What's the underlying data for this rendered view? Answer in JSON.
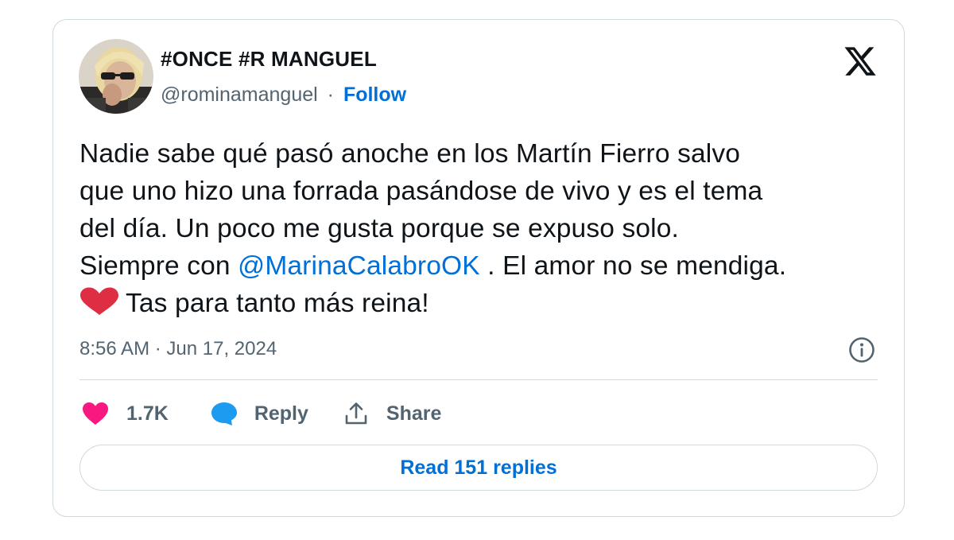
{
  "author": {
    "display_name": "#ONCE #R MANGUEL",
    "handle": "@rominamanguel",
    "separator": "·",
    "follow_label": "Follow",
    "avatar_icon": "avatar-photo"
  },
  "brand": {
    "logo_icon": "x-logo-icon"
  },
  "tweet": {
    "line1": "Nadie sabe qué pasó anoche en los Martín Fierro salvo",
    "line2": "que uno hizo una forrada pasándose de vivo y es el tema",
    "line3": "del día. Un poco me gusta porque se expuso solo.",
    "line4_before": "Siempre con ",
    "mention": "@MarinaCalabroOK",
    "line4_after": " . El amor no se mendiga.",
    "emoji": "red-heart-emoji",
    "line5": "Tas para tanto más reina!",
    "timestamp": "8:56 AM · Jun 17, 2024"
  },
  "actions": {
    "likes_count": "1.7K",
    "reply_label": "Reply",
    "share_label": "Share"
  },
  "read_replies_label": "Read 151 replies",
  "colors": {
    "link_blue": "#006fd6",
    "like_pink": "#f91880",
    "reply_blue": "#1d9bf0",
    "muted_gray": "#536471",
    "border": "#cfd9de"
  }
}
